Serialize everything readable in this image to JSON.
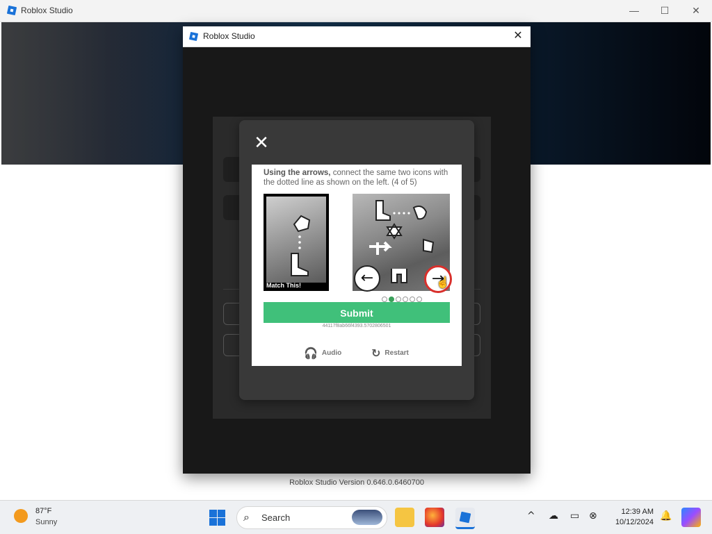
{
  "app": {
    "title": "Roblox Studio",
    "minimize": "—",
    "maximize": "☐",
    "close": "✕"
  },
  "dialog": {
    "title": "Roblox Studio",
    "close": "✕"
  },
  "captcha": {
    "close": "✕",
    "instruction_bold": "Using the arrows,",
    "instruction_rest": " connect the same two icons with the dotted line as shown on the left. (4 of 5)",
    "match_label": "Match This!",
    "left_arrow": "←",
    "right_arrow": "→",
    "submit_label": "Submit",
    "session_id": "44117f8ab66f4393.5702806501",
    "audio_label": "Audio",
    "restart_label": "Restart",
    "progress": {
      "current": 2,
      "total": 6
    }
  },
  "version": "Roblox Studio Version 0.646.0.6460700",
  "taskbar": {
    "temp": "87°F",
    "condition": "Sunny",
    "search_placeholder": "Search",
    "time": "12:39 AM",
    "date": "10/12/2024"
  },
  "colors": {
    "submit": "#40c07a",
    "active_arrow_border": "#d9302c",
    "roblox_blue": "#1a72d8"
  }
}
